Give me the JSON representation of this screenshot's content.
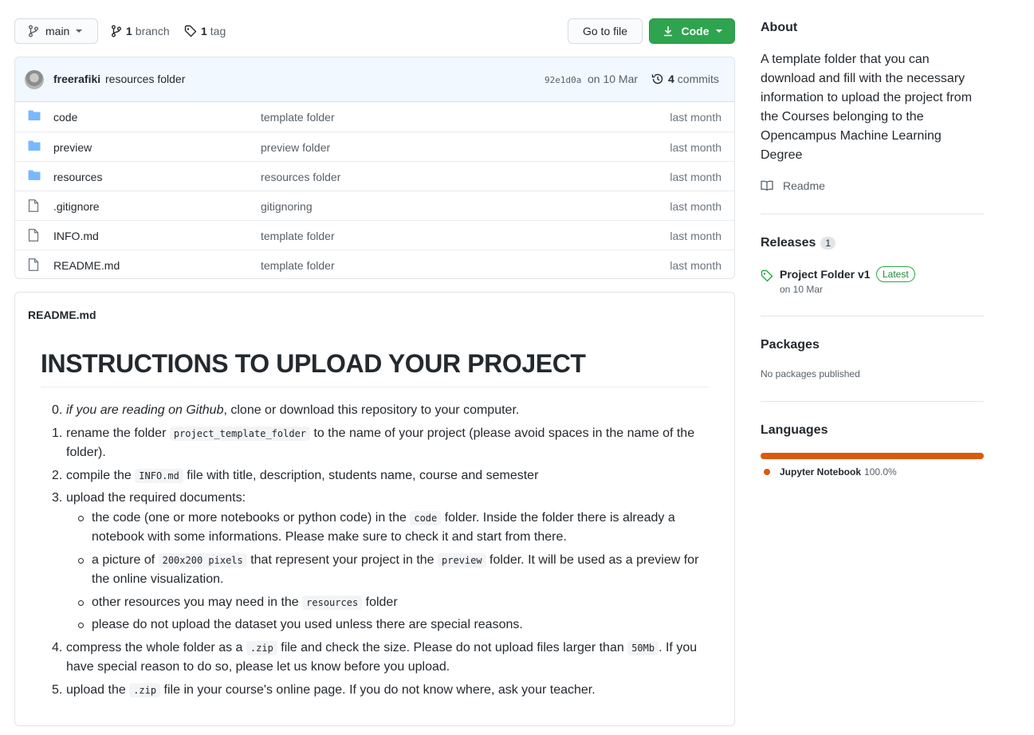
{
  "toolbar": {
    "branch": "main",
    "branch_count": "1",
    "branch_word": "branch",
    "tag_count": "1",
    "tag_word": "tag",
    "go_to_file": "Go to file",
    "code": "Code"
  },
  "commit": {
    "author": "freerafiki",
    "message": "resources folder",
    "sha": "92e1d0a",
    "date": "on 10 Mar",
    "count": "4",
    "count_word": "commits"
  },
  "files": [
    {
      "name": "code",
      "type": "folder",
      "message": "template folder",
      "age": "last month"
    },
    {
      "name": "preview",
      "type": "folder",
      "message": "preview folder",
      "age": "last month"
    },
    {
      "name": "resources",
      "type": "folder",
      "message": "resources folder",
      "age": "last month"
    },
    {
      "name": ".gitignore",
      "type": "file",
      "message": "gitignoring",
      "age": "last month"
    },
    {
      "name": "INFO.md",
      "type": "file",
      "message": "template folder",
      "age": "last month"
    },
    {
      "name": "README.md",
      "type": "file",
      "message": "template folder",
      "age": "last month"
    }
  ],
  "readme": {
    "filename": "README.md",
    "title": "INSTRUCTIONS TO UPLOAD YOUR PROJECT",
    "steps": {
      "s0_num": "0.",
      "s0_em": "if you are reading on Github",
      "s0_rest": ", clone or download this repository to your computer.",
      "s1_num": "1.",
      "s1_a": "rename the folder ",
      "s1_code": "project_template_folder",
      "s1_b": " to the name of your project (please avoid spaces in the name of the folder).",
      "s2_num": "2.",
      "s2_a": "compile the ",
      "s2_code": "INFO.md",
      "s2_b": " file with title, description, students name, course and semester",
      "s3_num": "3.",
      "s3_text": "upload the required documents:",
      "b1_a": "the code (one or more notebooks or python code) in the ",
      "b1_code": "code",
      "b1_b": " folder. Inside the folder there is already a notebook with some informations. Please make sure to check it and start from there.",
      "b2_a": "a picture of ",
      "b2_code": "200x200 pixels",
      "b2_b": " that represent your project in the ",
      "b2_code2": "preview",
      "b2_c": " folder. It will be used as a preview for the online visualization.",
      "b3_a": "other resources you may need in the ",
      "b3_code": "resources",
      "b3_b": " folder",
      "b4": "please do not upload the dataset you used unless there are special reasons.",
      "s4_num": "4.",
      "s4_a": "compress the whole folder as a ",
      "s4_code": ".zip",
      "s4_b": " file and check the size. Please do not upload files larger than ",
      "s4_code2": "50Mb",
      "s4_c": ". If you have special reason to do so, please let us know before you upload.",
      "s5_num": "5.",
      "s5_a": "upload the ",
      "s5_code": ".zip",
      "s5_b": " file in your course's online page. If you do not know where, ask your teacher."
    }
  },
  "sidebar": {
    "about_title": "About",
    "about_text": "A template folder that you can download and fill with the necessary information to upload the project from the Courses belonging to the Opencampus Machine Learning Degree",
    "readme_link": "Readme",
    "releases_title": "Releases",
    "releases_count": "1",
    "release_name": "Project Folder v1",
    "release_badge": "Latest",
    "release_date": "on 10 Mar",
    "packages_title": "Packages",
    "packages_empty": "No packages published",
    "languages_title": "Languages",
    "language_name": "Jupyter Notebook",
    "language_pct": "100.0%",
    "language_color": "#DA5B0B"
  }
}
